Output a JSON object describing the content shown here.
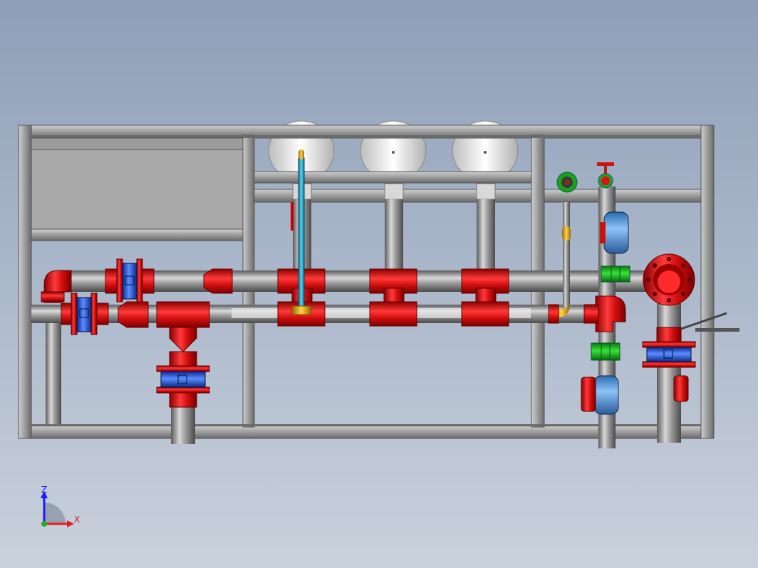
{
  "view": {
    "background_top": "#8d9fb7",
    "background_bottom": "#c9d1dc"
  },
  "colors": {
    "frame": "#9a9a9a",
    "panel": "#a8a8a8",
    "pipe_gray": "#8a8a8a",
    "fitting_red": "#d40f0f",
    "valve_blue": "#2a63d8",
    "union_green": "#19b21d",
    "ball_valve_blue": "#5aa0e6",
    "gauge_white": "#eeeeee",
    "sight_tube": "#28a8c8",
    "brass": "#e0a020"
  },
  "components": {
    "gauge_count": 3,
    "filter_columns": 3,
    "flanged_valves": 4,
    "ball_valves": 2,
    "unions": 2
  },
  "triad": {
    "z_label": "Z",
    "x_label": "X",
    "z_color": "#1a1aff",
    "x_color": "#e02020",
    "y_color": "#20b020"
  }
}
